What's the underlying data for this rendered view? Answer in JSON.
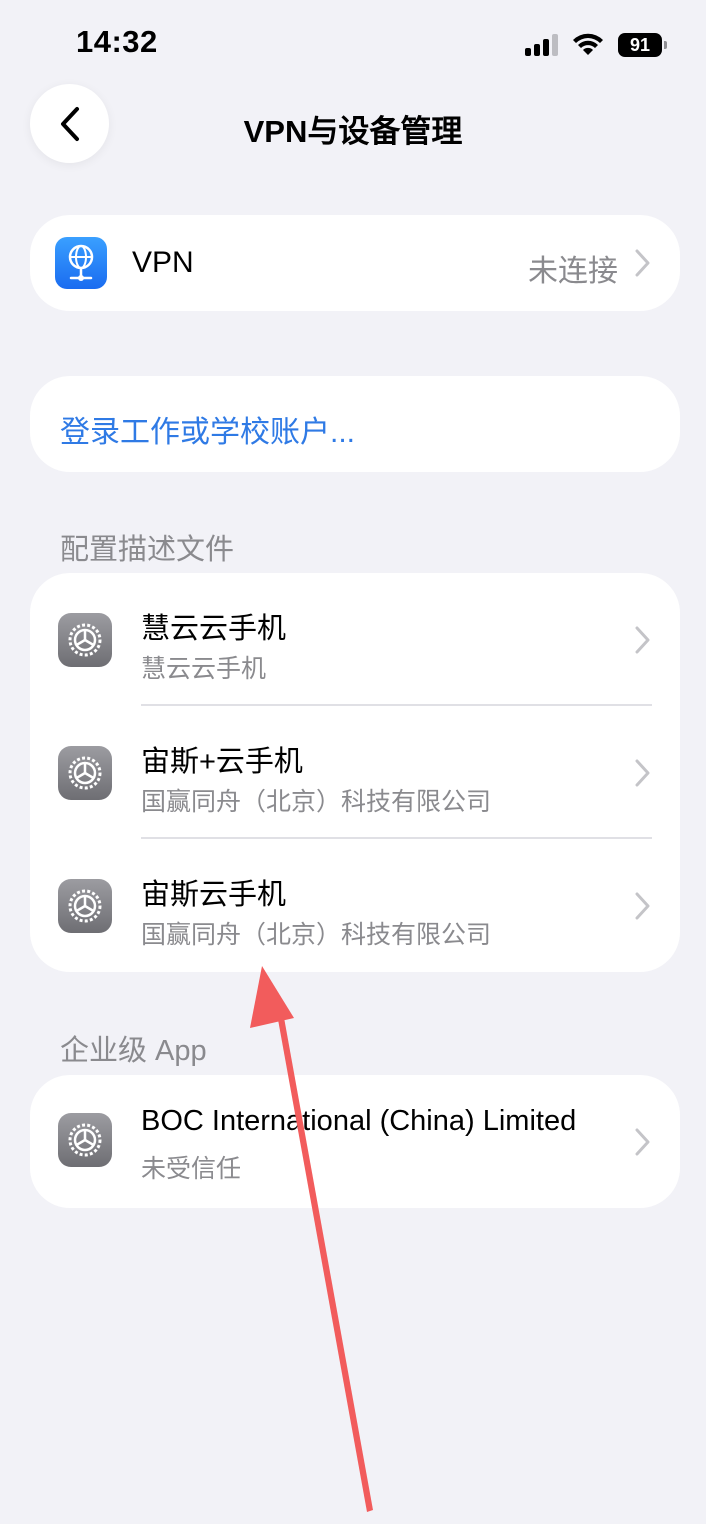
{
  "status_bar": {
    "time": "14:32",
    "battery": "91"
  },
  "nav": {
    "title": "VPN与设备管理"
  },
  "vpn": {
    "label": "VPN",
    "status": "未连接"
  },
  "login": {
    "label": "登录工作或学校账户..."
  },
  "profiles": {
    "header": "配置描述文件",
    "items": [
      {
        "title": "慧云云手机",
        "subtitle": "慧云云手机"
      },
      {
        "title": "宙斯+云手机",
        "subtitle": "国赢同舟（北京）科技有限公司"
      },
      {
        "title": "宙斯云手机",
        "subtitle": "国赢同舟（北京）科技有限公司"
      }
    ]
  },
  "enterprise": {
    "header": "企业级 App",
    "items": [
      {
        "title": "BOC International (China) Limited",
        "subtitle": "未受信任"
      }
    ]
  },
  "colors": {
    "accent": "#2f7ae5",
    "background": "#f2f2f7",
    "annotation_arrow": "#f25c5c"
  },
  "icons": [
    "back-chevron-icon",
    "vpn-globe-icon",
    "gear-icon",
    "chevron-right-icon",
    "signal-icon",
    "wifi-icon",
    "battery-icon"
  ]
}
